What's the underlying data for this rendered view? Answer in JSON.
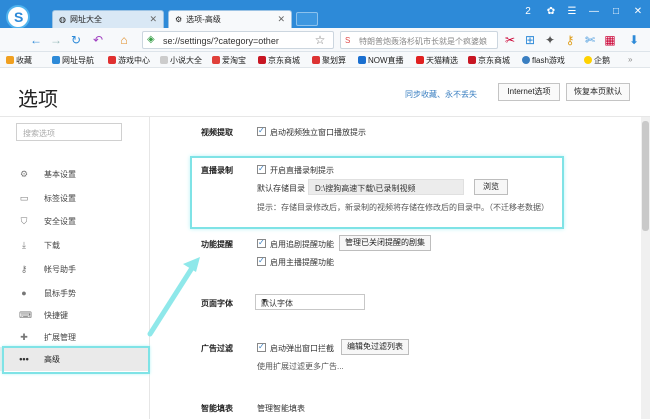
{
  "browser": {
    "tabs": [
      {
        "label": "网址大全",
        "icon": "globe-icon"
      },
      {
        "label": "选项-高级",
        "icon": "gear-icon"
      }
    ],
    "window_controls": [
      "2",
      "—",
      "□",
      "✕"
    ],
    "url": "se://settings/?category=other",
    "search_placeholder": "特朗普炮轰洛杉矶市长就是个疯婆娘",
    "bookmarks": [
      "收藏",
      "网址导航",
      "游戏中心",
      "小说大全",
      "爱淘宝",
      "京东商城",
      "聚划算",
      "NOW直播",
      "天猫精选",
      "京东商城",
      "flash游戏",
      "企鹅"
    ],
    "bookmark_icon_colors": [
      "#f0a020",
      "#2d8ad8",
      "#e03030",
      "#e8e8e8",
      "#e0403a",
      "#c81623",
      "#d33",
      "#1a6fd0",
      "#e02020",
      "#c81623",
      "#3a7fc1",
      "#ffd200"
    ]
  },
  "header": {
    "title": "选项",
    "sync_link": "同步收藏、永不丢失",
    "internet_options": "Internet选项",
    "restore_defaults": "恢复本页默认"
  },
  "sidebar": {
    "search_placeholder": "搜索选项",
    "items": [
      {
        "label": "基本设置",
        "icon": "gear-icon"
      },
      {
        "label": "标签设置",
        "icon": "tab-icon"
      },
      {
        "label": "安全设置",
        "icon": "shield-icon"
      },
      {
        "label": "下载",
        "icon": "download-icon"
      },
      {
        "label": "帐号助手",
        "icon": "key-icon"
      },
      {
        "label": "鼠标手势",
        "icon": "mouse-icon"
      },
      {
        "label": "快捷键",
        "icon": "keyboard-icon"
      },
      {
        "label": "扩展管理",
        "icon": "puzzle-icon"
      },
      {
        "label": "高级",
        "icon": "more-icon",
        "active": true
      }
    ]
  },
  "main": {
    "video": {
      "label": "视频提取",
      "option": "启动视频独立窗口播放提示",
      "checked": true
    },
    "live": {
      "label": "直播录制",
      "option": "开启直播录制提示",
      "checked": true,
      "dir_label": "默认存储目录",
      "dir_value": "D:\\搜狗高速下载\\已录制视频",
      "browse": "浏览",
      "hint": "提示：存储目录修改后，新录制的视频将存储在修改后的目录中。（不迁移老数据）"
    },
    "reminder": {
      "label": "功能提醒",
      "option1": "启用追剧提醒功能",
      "option1_checked": true,
      "manage_button": "管理已关闭提醒的剧集",
      "option2": "启用主播提醒功能",
      "option2_checked": true
    },
    "font": {
      "label": "页面字体",
      "value": "默认字体"
    },
    "adblock": {
      "label": "广告过滤",
      "option": "启动弹出窗口拦截",
      "checked": true,
      "edit_button": "编辑免过滤列表",
      "note": "使用扩展过滤更多广告..."
    },
    "autofill": {
      "label": "智能填表",
      "manage": "管理智能填表"
    }
  }
}
